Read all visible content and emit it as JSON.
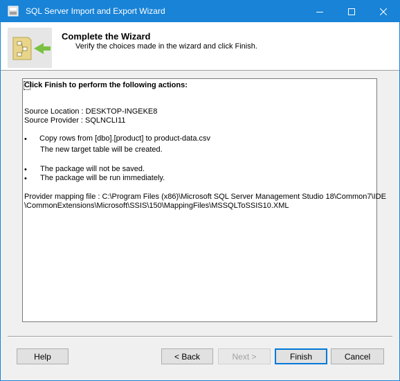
{
  "window": {
    "title": "SQL Server Import and Export Wizard",
    "accent_color": "#1883d7",
    "controls": [
      "minimize-icon",
      "maximize-icon",
      "close-icon"
    ]
  },
  "header": {
    "title": "Complete the Wizard",
    "subtitle": "Verify the choices made in the wizard and click Finish."
  },
  "summary": {
    "heading": "Click Finish to perform the following actions:",
    "source_location": "Source Location : DESKTOP-INGEKE8",
    "source_provider": "Source Provider : SQLNCLI11",
    "actions": [
      "Copy rows from [dbo].[product] to product-data.csv",
      "The new target table will be created.",
      "The package will not be saved.",
      "The package will be run immediately."
    ],
    "bullet": "•",
    "mapping_line1": "Provider mapping file : C:\\Program Files (x86)\\Microsoft SQL Server Management Studio 18\\Common7\\IDE",
    "mapping_line2": "\\CommonExtensions\\Microsoft\\SSIS\\150\\MappingFiles\\MSSQLToSSIS10.XML"
  },
  "buttons": {
    "help": "Help",
    "back": "< Back",
    "next": "Next >",
    "finish": "Finish",
    "cancel": "Cancel"
  }
}
